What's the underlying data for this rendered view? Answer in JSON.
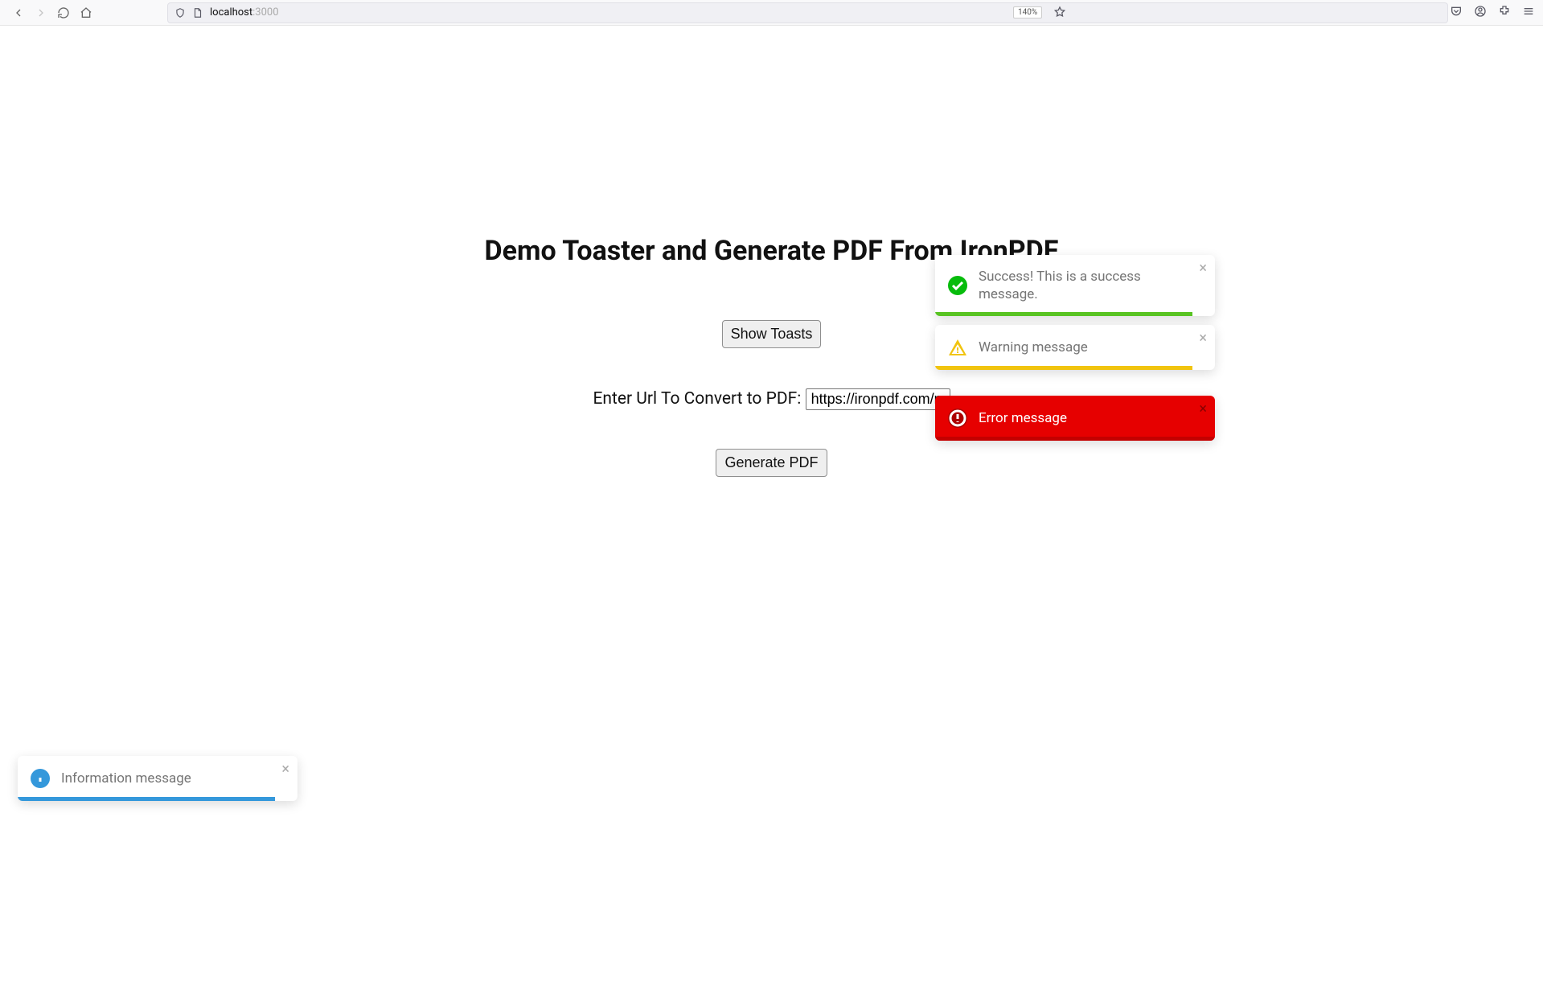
{
  "browser": {
    "url_host": "localhost",
    "url_port": ":3000",
    "zoom": "140%"
  },
  "page": {
    "title": "Demo Toaster and Generate PDF From IronPDF",
    "show_toasts_button": "Show Toasts",
    "url_label": "Enter Url To Convert to PDF:",
    "url_value": "https://ironpdf.com/nodejs",
    "generate_button": "Generate PDF"
  },
  "toasts": {
    "success": {
      "message": "Success! This is a success message.",
      "bar_color": "#58c322"
    },
    "warning": {
      "message": "Warning message",
      "bar_color": "#f1c40f"
    },
    "error": {
      "message": "Error message",
      "bar_color": "#c40000"
    },
    "info": {
      "message": "Information message",
      "bar_color": "#3498db"
    }
  }
}
